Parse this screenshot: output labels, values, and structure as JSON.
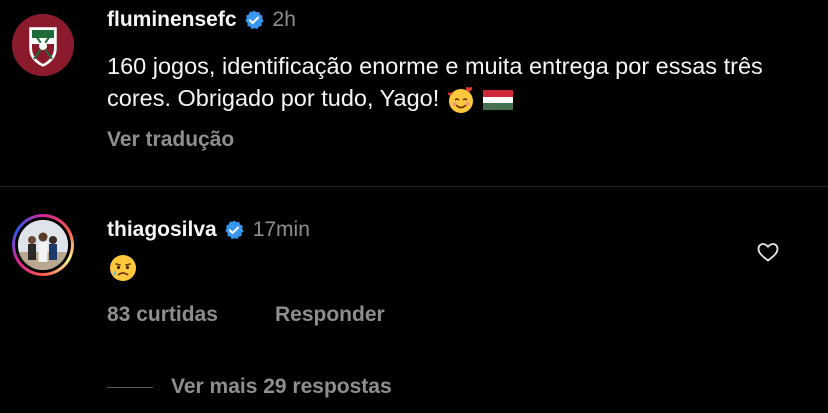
{
  "post": {
    "username": "fluminensefc",
    "time": "2h",
    "text": "160 jogos, identificação enorme e muita entrega por essas três cores. Obrigado por tudo, Yago!",
    "translate_label": "Ver tradução"
  },
  "reply": {
    "username": "thiagosilva",
    "time": "17min",
    "likes_label": "83 curtidas",
    "reply_label": "Responder"
  },
  "view_more_label": "Ver mais 29 respostas",
  "colors": {
    "background": "#000000",
    "text": "#f5f5f5",
    "muted": "#8e8e8e",
    "verified": "#3897f0"
  }
}
